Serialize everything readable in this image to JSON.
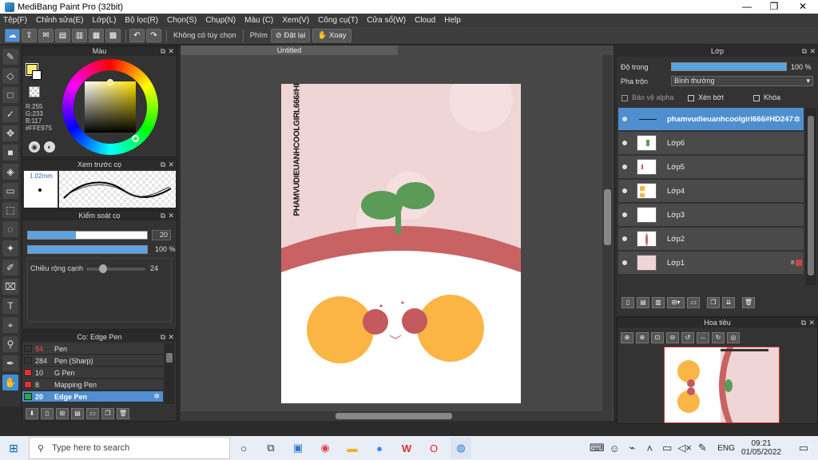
{
  "window": {
    "title": "MediBang Paint Pro (32bit)",
    "min": "—",
    "max": "❐",
    "close": "✕"
  },
  "menu": [
    "Tệp(F)",
    "Chỉnh sửa(E)",
    "Lớp(L)",
    "Bộ lọc(R)",
    "Chọn(S)",
    "Chụp(N)",
    "Màu (C)",
    "Xem(V)",
    "Công cụ(T)",
    "Cửa sổ(W)",
    "Cloud",
    "Help"
  ],
  "toolbar": {
    "no_selection": "Không có tùy chọn",
    "key_label": "Phím",
    "reset": "Đặt lại",
    "rotate": "Xoay"
  },
  "color_panel": {
    "title": "Màu",
    "r": "R:255",
    "g": "G:233",
    "b": "B:117",
    "hex": "#FFE975",
    "primary": "#ffe975"
  },
  "brush_preview": {
    "title": "Xem trước cọ",
    "size": "1.02mm"
  },
  "brush_control": {
    "title": "Kiểm soát cọ",
    "size_value": "20",
    "opacity_value": "100 %",
    "edge_label": "Chiều rộng cạnh",
    "edge_value": "24",
    "size_fraction": 0.4,
    "opacity_fraction": 1.0,
    "edge_fraction": 0.27
  },
  "brush_list": {
    "title": "Cọ: Edge Pen",
    "items": [
      {
        "size": "84",
        "name": "Pen",
        "color": "#333333",
        "size_color": "#e05050"
      },
      {
        "size": "284",
        "name": "Pen (Sharp)",
        "color": "#333333",
        "size_color": "#dddddd"
      },
      {
        "size": "10",
        "name": "G Pen",
        "color": "#e33030",
        "size_color": "#dddddd"
      },
      {
        "size": "8",
        "name": "Mapping Pen",
        "color": "#e33030",
        "size_color": "#dddddd"
      },
      {
        "size": "20",
        "name": "Edge Pen",
        "color": "#2aa84a",
        "size_color": "#ffffff",
        "selected": true
      }
    ]
  },
  "document": {
    "tab": "Untitled",
    "vertical_text": "PHAMVUDIEUANHCOOLGIRL666#HD247"
  },
  "layers_panel": {
    "title": "Lớp",
    "opacity_label": "Độ trong",
    "opacity_value": "100 %",
    "opacity_fraction": 1.0,
    "blend_label": "Pha trộn",
    "blend_value": "Bình thường",
    "alpha_label": "Bảo vệ alpha",
    "clip_label": "Xén bớt",
    "lock_label": "Khóa",
    "layers": [
      {
        "name": "phamvudieuanhcoolgirl666#HD247",
        "selected": true
      },
      {
        "name": "Lớp6"
      },
      {
        "name": "Lớp5"
      },
      {
        "name": "Lớp4"
      },
      {
        "name": "Lớp3"
      },
      {
        "name": "Lớp2"
      },
      {
        "name": "Lớp1",
        "badge": "8"
      }
    ]
  },
  "navigator": {
    "title": "Hoa tiêu"
  },
  "taskbar": {
    "search_placeholder": "Type here to search",
    "lang": "ENG",
    "time": "09:21",
    "date": "01/05/2022"
  }
}
